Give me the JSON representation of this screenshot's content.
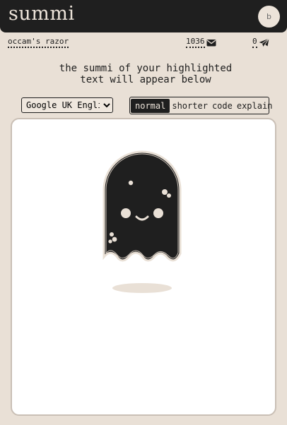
{
  "app": {
    "logo": "summi",
    "avatar_initial": "b"
  },
  "stats": {
    "link_label": "occam's razor",
    "count": "1036",
    "sent": "0"
  },
  "instructions": {
    "line1": "the summi of your highlighted",
    "line2": "text will appear below"
  },
  "language": {
    "selected": "Google UK English"
  },
  "modes": [
    {
      "label": "normal",
      "active": true
    },
    {
      "label": "shorter",
      "active": false
    },
    {
      "label": "code",
      "active": false
    },
    {
      "label": "explain",
      "active": false
    }
  ],
  "colors": {
    "dark": "#1f1f1f",
    "cream": "#e9e0d6",
    "panel": "#ffffff"
  },
  "icons": {
    "count_icon": "envelope-icon",
    "sent_icon": "paper-plane-icon"
  },
  "illustration": {
    "name": "ghost-mascot"
  }
}
